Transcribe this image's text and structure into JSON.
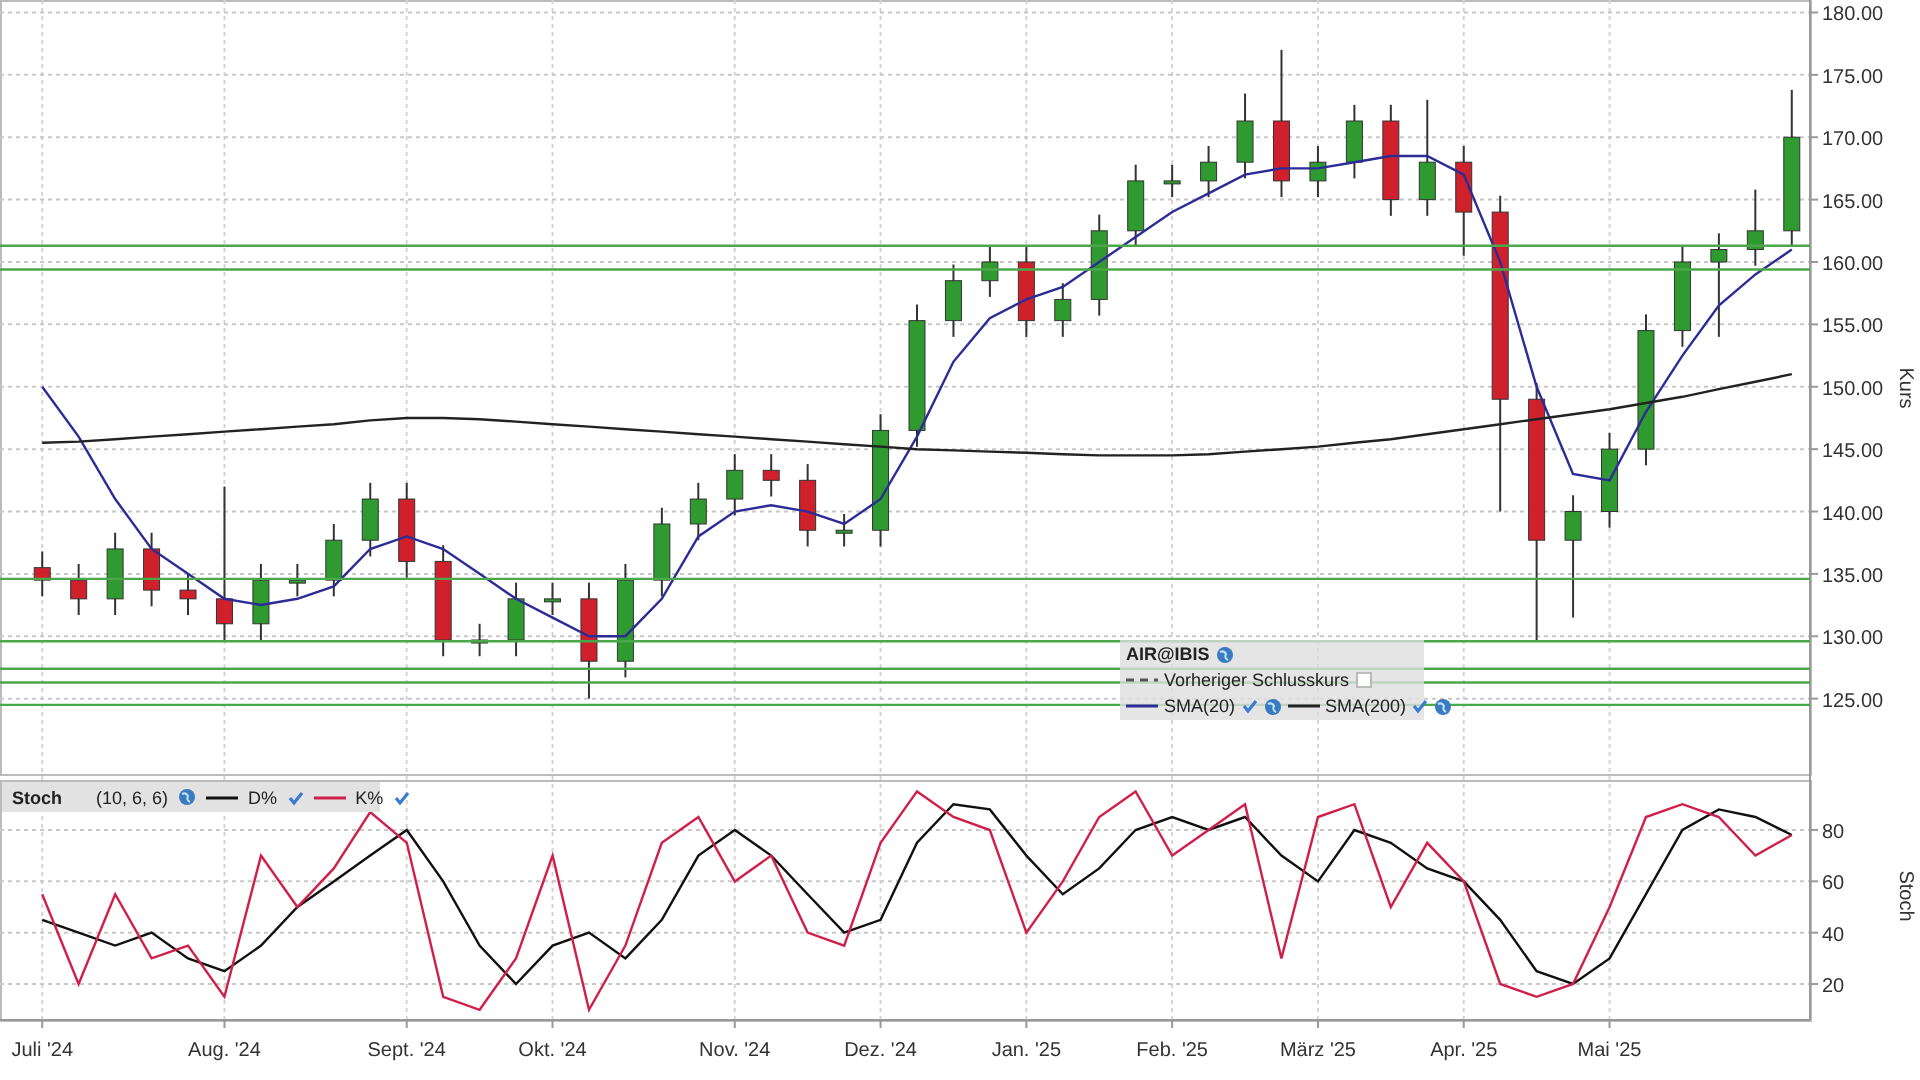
{
  "price_chart": {
    "axis_title": "Kurs",
    "legend": {
      "title": "AIR@IBIS",
      "items": [
        {
          "kind": "reference",
          "label": "Vorheriger Schlusskurs",
          "checked": false
        },
        {
          "kind": "series",
          "checked": true
        },
        {
          "kind": "series",
          "checked": true
        }
      ]
    },
    "chart_data": {
      "type": "candlestick",
      "ylim": [
        118.8,
        181
      ],
      "grid": true,
      "categories": [
        null,
        null,
        null,
        null,
        null,
        null,
        null,
        null,
        null,
        null,
        null,
        null,
        null,
        null,
        null,
        null,
        null,
        null,
        null,
        null,
        null,
        null,
        null,
        null,
        null,
        null,
        null,
        null,
        null,
        null,
        null,
        null,
        null,
        null,
        null,
        null,
        null,
        null,
        null,
        null,
        null,
        null,
        null,
        null,
        null,
        null,
        null,
        null,
        null
      ],
      "yticks": [
        {
          "value": 125,
          "label": "125.00"
        },
        {
          "value": 130,
          "label": "130.00"
        },
        {
          "value": 135,
          "label": "135.00"
        },
        {
          "value": 140,
          "label": "140.00"
        },
        {
          "value": 145,
          "label": "145.00"
        },
        {
          "value": 150,
          "label": "150.00"
        },
        {
          "value": 155,
          "label": "155.00"
        },
        {
          "value": 160,
          "label": "160.00"
        },
        {
          "value": 165,
          "label": "165.00"
        },
        {
          "value": 170,
          "label": "170.00"
        },
        {
          "value": 175,
          "label": "175.00"
        },
        {
          "value": 180,
          "label": "180.00"
        }
      ],
      "ohlc": [
        [
          135.5,
          136.8,
          133.2,
          134.5
        ],
        [
          134.5,
          135.8,
          131.7,
          133
        ],
        [
          133,
          138.3,
          131.7,
          137
        ],
        [
          137,
          138.3,
          132.4,
          133.7
        ],
        [
          133.7,
          135,
          131.7,
          133
        ],
        [
          133,
          142,
          129.7,
          131
        ],
        [
          131,
          135.8,
          129.7,
          134.5
        ],
        [
          134.5,
          135.8,
          133.2,
          134.5
        ],
        [
          134.5,
          139,
          133.2,
          137.7
        ],
        [
          137.7,
          142.3,
          136.4,
          141
        ],
        [
          141,
          142.3,
          134.7,
          136
        ],
        [
          136,
          137.3,
          128.4,
          129.7
        ],
        [
          129.7,
          131,
          128.4,
          129.7
        ],
        [
          129.7,
          134.3,
          128.4,
          133
        ],
        [
          133,
          134.3,
          131.7,
          133
        ],
        [
          133,
          134.3,
          125,
          128
        ],
        [
          128,
          135.8,
          126.7,
          134.5
        ],
        [
          134.5,
          140.3,
          133.2,
          139
        ],
        [
          139,
          142.3,
          137.7,
          141
        ],
        [
          141,
          144.6,
          139.7,
          143.3
        ],
        [
          143.3,
          144.6,
          141.2,
          142.5
        ],
        [
          142.5,
          143.8,
          137.2,
          138.5
        ],
        [
          138.5,
          139.8,
          137.2,
          138.5
        ],
        [
          138.5,
          147.8,
          137.2,
          146.5
        ],
        [
          146.5,
          156.6,
          145.2,
          155.3
        ],
        [
          155.3,
          159.8,
          154,
          158.5
        ],
        [
          158.5,
          161.3,
          157.2,
          160
        ],
        [
          160,
          161.3,
          154,
          155.3
        ],
        [
          155.3,
          158.3,
          154,
          157
        ],
        [
          157,
          163.8,
          155.7,
          162.5
        ],
        [
          162.5,
          167.8,
          161.2,
          166.5
        ],
        [
          166.5,
          167.8,
          165.2,
          166.5
        ],
        [
          166.5,
          169.3,
          165.2,
          168
        ],
        [
          168,
          173.5,
          166.7,
          171.3
        ],
        [
          171.3,
          177,
          165.2,
          166.5
        ],
        [
          166.5,
          169.3,
          165.2,
          168
        ],
        [
          168,
          172.6,
          166.7,
          171.3
        ],
        [
          171.3,
          172.6,
          163.7,
          165
        ],
        [
          165,
          173,
          163.7,
          168
        ],
        [
          168,
          169.3,
          160.5,
          164
        ],
        [
          164,
          165.3,
          140,
          149
        ],
        [
          149,
          150.3,
          129.7,
          137.7
        ],
        [
          137.7,
          141.3,
          131.5,
          140
        ],
        [
          140,
          146.3,
          138.7,
          145
        ],
        [
          145,
          155.8,
          143.7,
          154.5
        ],
        [
          154.5,
          161.3,
          153.2,
          160
        ],
        [
          160,
          162.3,
          154,
          161
        ],
        [
          161,
          165.8,
          159.7,
          162.5
        ],
        [
          162.5,
          173.8,
          161.2,
          170
        ]
      ],
      "series": [
        {
          "name": "SMA(20)",
          "type": "line",
          "color": "#2c2c96",
          "values": [
            150,
            146,
            141,
            137,
            135,
            133,
            132.5,
            133,
            134,
            137,
            138,
            137,
            135,
            133,
            131.5,
            130,
            130,
            133,
            138,
            140,
            140.5,
            140,
            139,
            141,
            146,
            152,
            155.5,
            157,
            158,
            160,
            162,
            164,
            165.5,
            167,
            167.5,
            167.5,
            168,
            168.5,
            168.5,
            167,
            160,
            150,
            143,
            142.5,
            148,
            152.5,
            156.5,
            159,
            161
          ]
        },
        {
          "name": "SMA(200)",
          "type": "line",
          "color": "#222222",
          "values": [
            145.5,
            145.6,
            145.8,
            146,
            146.2,
            146.4,
            146.6,
            146.8,
            147,
            147.3,
            147.5,
            147.5,
            147.4,
            147.2,
            147,
            146.8,
            146.6,
            146.4,
            146.2,
            146,
            145.8,
            145.6,
            145.4,
            145.2,
            145,
            144.9,
            144.8,
            144.7,
            144.6,
            144.5,
            144.5,
            144.5,
            144.6,
            144.8,
            145,
            145.2,
            145.5,
            145.8,
            146.2,
            146.6,
            147,
            147.4,
            147.8,
            148.2,
            148.7,
            149.2,
            149.8,
            150.4,
            151
          ]
        }
      ],
      "ref_lines": [
        {
          "axis": "y",
          "value": 161.3
        },
        {
          "axis": "y",
          "value": 159.4
        },
        {
          "axis": "y",
          "value": 134.6
        },
        {
          "axis": "y",
          "value": 129.6
        },
        {
          "axis": "y",
          "value": 127.4
        },
        {
          "axis": "y",
          "value": 126.3
        },
        {
          "axis": "y",
          "value": 124.5
        }
      ]
    }
  },
  "stoch_chart": {
    "axis_title": "Stoch",
    "legend": {
      "title": "Stoch",
      "params": "(10, 6, 6)",
      "items": [
        {
          "checked": true
        },
        {
          "checked": true
        }
      ]
    },
    "chart_data": {
      "type": "line",
      "ylim": [
        6,
        101
      ],
      "grid": true,
      "yticks": [
        20,
        40,
        60,
        80
      ],
      "categories": [
        "Juli '24",
        null,
        null,
        null,
        null,
        "Aug. '24",
        null,
        null,
        null,
        null,
        "Sept. '24",
        null,
        null,
        null,
        "Okt. '24",
        null,
        null,
        null,
        null,
        "Nov. '24",
        null,
        null,
        null,
        "Dez. '24",
        null,
        null,
        null,
        "Jan. '25",
        null,
        null,
        null,
        "Feb. '25",
        null,
        null,
        null,
        "März '25",
        null,
        null,
        null,
        "Apr. '25",
        null,
        null,
        null,
        "Mai '25",
        null,
        null,
        null,
        null,
        null
      ],
      "series": [
        {
          "name": "D%",
          "color": "#111111",
          "values": [
            45,
            40,
            35,
            40,
            30,
            25,
            35,
            50,
            60,
            70,
            80,
            60,
            35,
            20,
            35,
            40,
            30,
            45,
            70,
            80,
            70,
            55,
            40,
            45,
            75,
            90,
            88,
            70,
            55,
            65,
            80,
            85,
            80,
            85,
            70,
            60,
            80,
            75,
            65,
            60,
            45,
            25,
            20,
            30,
            55,
            80,
            88,
            85,
            78
          ]
        },
        {
          "name": "K%",
          "color": "#d0204a",
          "values": [
            55,
            20,
            55,
            30,
            35,
            15,
            70,
            50,
            65,
            87,
            75,
            15,
            10,
            30,
            70,
            10,
            35,
            75,
            85,
            60,
            70,
            40,
            35,
            75,
            95,
            85,
            80,
            40,
            60,
            85,
            95,
            70,
            80,
            90,
            30,
            85,
            90,
            50,
            75,
            60,
            20,
            15,
            20,
            50,
            85,
            90,
            85,
            70,
            78
          ]
        }
      ]
    }
  }
}
